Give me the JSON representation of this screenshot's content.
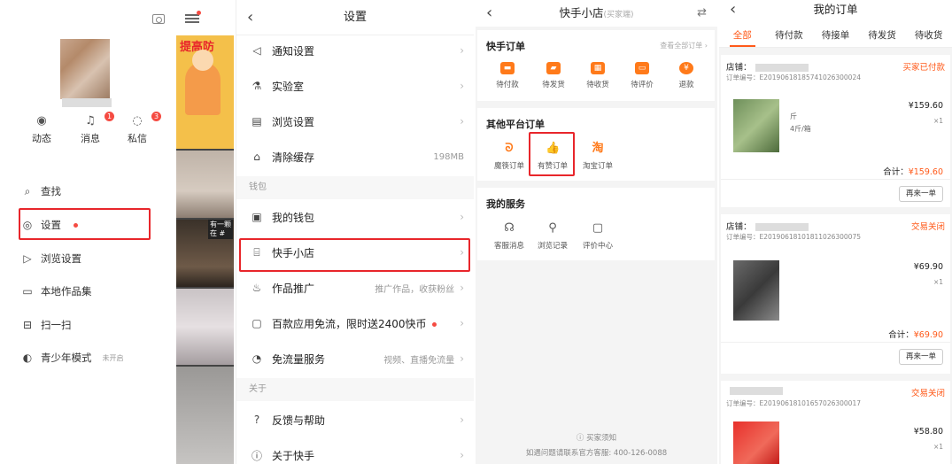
{
  "sidebar": {
    "quick_actions": [
      {
        "label": "动态",
        "icon": "eye-icon"
      },
      {
        "label": "消息",
        "icon": "bell-icon",
        "badge": "1"
      },
      {
        "label": "私信",
        "icon": "chat-icon",
        "badge": "3"
      }
    ],
    "menu": [
      {
        "label": "查找",
        "icon": "search-icon"
      },
      {
        "label": "设置",
        "icon": "settings-icon"
      },
      {
        "label": "浏览设置",
        "icon": "play-icon"
      },
      {
        "label": "本地作品集",
        "icon": "folder-icon"
      },
      {
        "label": "扫一扫",
        "icon": "scan-icon"
      },
      {
        "label": "青少年模式",
        "icon": "shield-icon",
        "tag": "未开启"
      }
    ]
  },
  "feed": {
    "tile1_caption": "提高防",
    "tile3_caption": "有一颗\n在 #"
  },
  "settings": {
    "title": "设置",
    "rows": [
      {
        "label": "通知设置",
        "icon": "speaker-icon",
        "value": ""
      },
      {
        "label": "实验室",
        "icon": "flask-icon",
        "value": ""
      },
      {
        "label": "浏览设置",
        "icon": "browse-icon",
        "value": ""
      },
      {
        "label": "清除缓存",
        "icon": "broom-icon",
        "value": "198MB"
      }
    ],
    "section_wallet": "钱包",
    "wallet_rows": [
      {
        "label": "我的钱包",
        "icon": "wallet-icon",
        "value": ""
      },
      {
        "label": "快手小店",
        "icon": "shop-icon",
        "value": ""
      },
      {
        "label": "作品推广",
        "icon": "flame-icon",
        "value": "推广作品，收获粉丝"
      },
      {
        "label": "百款应用免流，限时送2400快币",
        "icon": "coin-card-icon",
        "value": ""
      },
      {
        "label": "免流量服务",
        "icon": "data-icon",
        "value": "视频、直播免流量"
      }
    ],
    "section_about": "关于",
    "about_rows": [
      {
        "label": "反馈与帮助",
        "icon": "help-icon",
        "value": ""
      },
      {
        "label": "关于快手",
        "icon": "info-icon",
        "value": ""
      }
    ]
  },
  "shop": {
    "title": "快手小店",
    "subtitle": "(买家端)",
    "orders_title": "快手订单",
    "orders_link": "查看全部订单",
    "order_items": [
      "待付款",
      "待发货",
      "待收货",
      "待评价",
      "退款"
    ],
    "platform_title": "其他平台订单",
    "platform_items": [
      {
        "label": "魔筷订单",
        "icon": "mokuai-icon",
        "glyph": "ᘐ"
      },
      {
        "label": "有赞订单",
        "icon": "thumbs-up-icon",
        "glyph": "👍"
      },
      {
        "label": "淘宝订单",
        "icon": "taobao-icon",
        "glyph": "淘"
      }
    ],
    "services_title": "我的服务",
    "services": [
      {
        "label": "客服消息",
        "icon": "headset-icon"
      },
      {
        "label": "浏览记录",
        "icon": "footprint-icon"
      },
      {
        "label": "评价中心",
        "icon": "review-icon"
      }
    ],
    "footer_link": "买家须知",
    "footer_text": "如遇问题请联系官方客服: 400-126-0088"
  },
  "orders": {
    "title": "我的订单",
    "tabs": [
      "全部",
      "待付款",
      "待接单",
      "待发货",
      "待收货"
    ],
    "cards": [
      {
        "shop_label": "店铺：",
        "status": "买家已付款",
        "order_no": "订单编号：E2019061818574102630002​4",
        "spec_title": "斤",
        "spec": "4斤/箱",
        "price": "¥159.60",
        "qty": "×1",
        "total_label": "合计：",
        "total": "¥159.60",
        "rebuy": "再来一单"
      },
      {
        "shop_label": "店铺：",
        "status": "交易关闭",
        "order_no": "订单编号：E201906181018110263000​75",
        "spec_title": "",
        "spec": "",
        "price": "¥69.90",
        "qty": "×1",
        "total_label": "合计：",
        "total": "¥69.90",
        "rebuy": "再来一单"
      },
      {
        "shop_label": "",
        "status": "交易关闭",
        "order_no": "订单编号：E201906181016570263000​17",
        "spec_title": "",
        "spec": "",
        "price": "¥58.80",
        "qty": "×1",
        "total_label": "",
        "total": "",
        "rebuy": ""
      }
    ]
  },
  "colors": {
    "accent": "#ff5a1a",
    "highlight": "#e8262b",
    "badge": "#f54b42"
  }
}
